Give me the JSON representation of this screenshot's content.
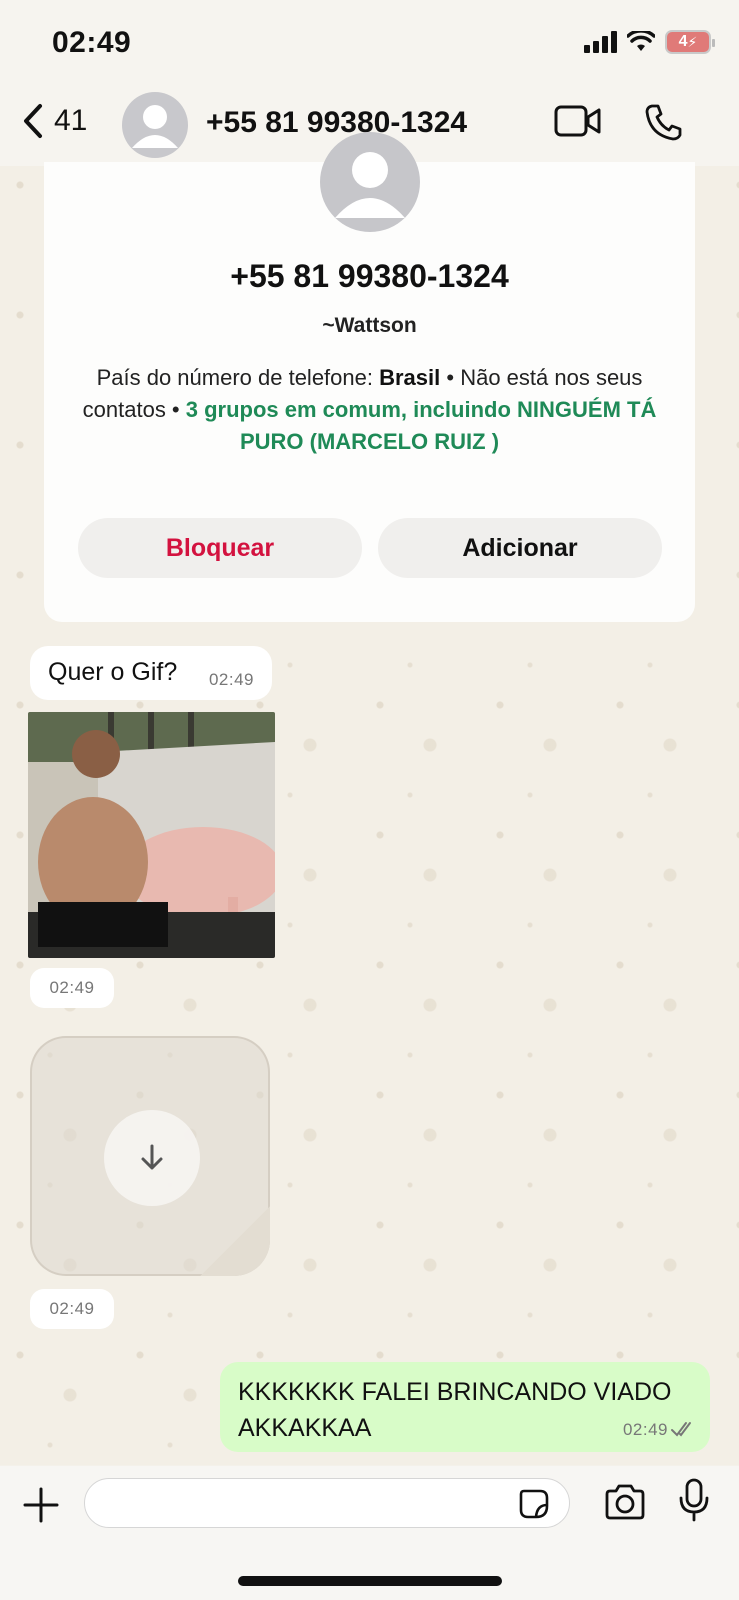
{
  "status": {
    "time": "02:49",
    "battery": "4"
  },
  "nav": {
    "back_count": "41",
    "title": "+55 81 99380-1324"
  },
  "contact_card": {
    "phone": "+55 81 99380-1324",
    "alias": "~Wattson",
    "country_label": "País do número de telefone: ",
    "country": "Brasil",
    "not_in_contacts": " • Não está nos seus contatos • ",
    "groups": "3 grupos em comum, incluindo NINGUÉM TÁ PURO (MARCELO RUIZ )",
    "block_label": "Bloquear",
    "add_label": "Adicionar"
  },
  "messages": [
    {
      "text": "Quer o Gif?",
      "time": "02:49"
    },
    {
      "type": "photo",
      "time": "02:49"
    },
    {
      "type": "sticker",
      "time": "02:49"
    },
    {
      "text": "KKKKKKK FALEI BRINCANDO VIADO AKKAKKAA",
      "time": "02:49",
      "outgoing": true
    }
  ],
  "input": {
    "placeholder": ""
  },
  "colors": {
    "accent_green": "#1f8a57",
    "block_red": "#d3123f",
    "outgoing_bubble": "#d8fcc8"
  }
}
